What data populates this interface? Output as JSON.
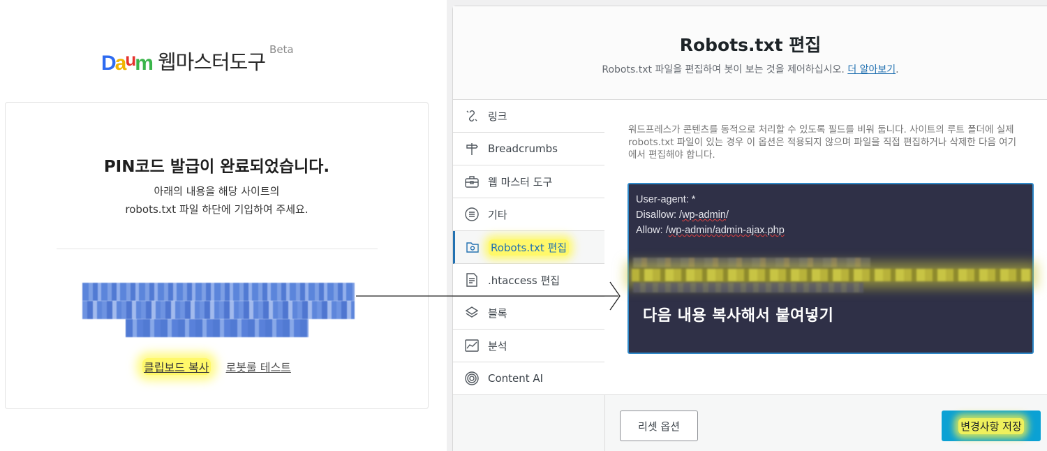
{
  "left": {
    "logo_letters": [
      "D",
      "a",
      "u",
      "m"
    ],
    "logo_colors": [
      "#2e6bf0",
      "#f0b400",
      "#e5322d",
      "#3ab54a"
    ],
    "brand_title": "웹마스터도구",
    "beta": "Beta",
    "card_title": "PIN코드 발급이 완료되었습니다.",
    "card_desc_1": "아래의 내용을 해당 사이트의",
    "card_desc_2": "robots.txt 파일 하단에 기입하여 주세요.",
    "copy_label": "클립보드 복사",
    "test_label": "로봇룰 테스트"
  },
  "editor": {
    "title": "Robots.txt 편집",
    "subtitle": "Robots.txt 파일을 편집하여 봇이 보는 것을 제어하십시오.",
    "learn_more": "더 알아보기",
    "learn_more_suffix": ".",
    "menu": [
      {
        "label": "링크",
        "icon": "link-icon"
      },
      {
        "label": "Breadcrumbs",
        "icon": "signpost-icon"
      },
      {
        "label": "웹 마스터 도구",
        "icon": "toolbox-icon"
      },
      {
        "label": "기타",
        "icon": "list-circle-icon"
      },
      {
        "label": "Robots.txt 편집",
        "icon": "robots-file-icon",
        "active": true
      },
      {
        "label": ".htaccess 편집",
        "icon": "document-icon"
      },
      {
        "label": "블록",
        "icon": "blocks-icon"
      },
      {
        "label": "분석",
        "icon": "analytics-icon"
      },
      {
        "label": "Content AI",
        "icon": "content-ai-icon"
      }
    ],
    "help_text": "워드프레스가 콘텐츠를 동적으로 처리할 수 있도록 필드를 비워 둡니다. 사이트의 루트 폴더에 실제 robots.txt 파일이 있는 경우 이 옵션은 적용되지 않으며 파일을 직접 편집하거나 삭제한 다음 여기에서 편집해야 합니다.",
    "code": {
      "line1": "User-agent: *",
      "line2_prefix": "Disallow: /",
      "line2_word": "wp-admin",
      "line2_suffix": "/",
      "line3_prefix": "Allow: /",
      "line3_word": "wp-admin/admin-ajax.php",
      "overlay": "다음 내용 복사해서 붙여넣기"
    },
    "reset_label": "리셋 옵션",
    "save_label": "변경사항 저장",
    "accent_color": "#2271b1",
    "save_color": "#0ba1d4",
    "highlight_color": "#fff86a"
  }
}
